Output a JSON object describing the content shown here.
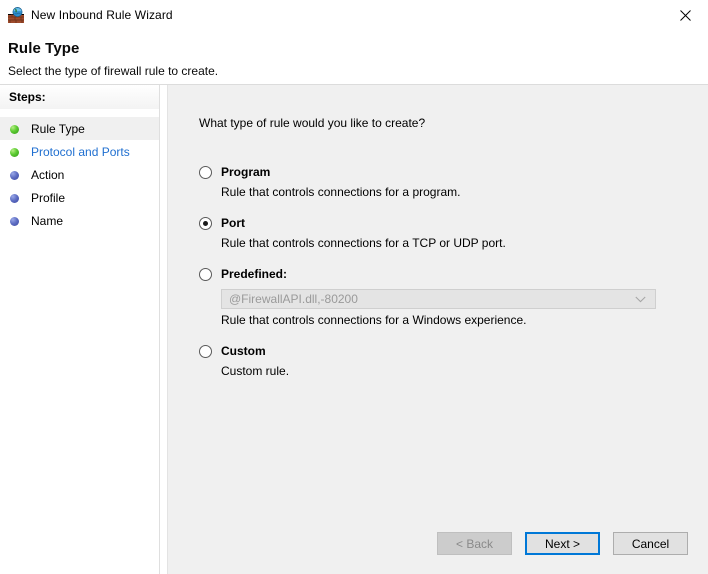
{
  "window": {
    "title": "New Inbound Rule Wizard",
    "icon": "firewall-globe-icon",
    "close_label": "close-icon"
  },
  "header": {
    "title": "Rule Type",
    "subtitle": "Select the type of firewall rule to create."
  },
  "sidebar": {
    "heading": "Steps:",
    "items": [
      {
        "label": "Rule Type",
        "state": "current",
        "bullet": "green"
      },
      {
        "label": "Protocol and Ports",
        "state": "link",
        "bullet": "green"
      },
      {
        "label": "Action",
        "state": "pending",
        "bullet": "blue"
      },
      {
        "label": "Profile",
        "state": "pending",
        "bullet": "blue"
      },
      {
        "label": "Name",
        "state": "pending",
        "bullet": "blue"
      }
    ]
  },
  "main": {
    "question": "What type of rule would you like to create?",
    "options": [
      {
        "label": "Program",
        "description": "Rule that controls connections for a program.",
        "selected": false
      },
      {
        "label": "Port",
        "description": "Rule that controls connections for a TCP or UDP port.",
        "selected": true
      },
      {
        "label": "Predefined:",
        "description": "Rule that controls connections for a Windows experience.",
        "selected": false,
        "combo_value": "@FirewallAPI.dll,-80200",
        "combo_disabled": true
      },
      {
        "label": "Custom",
        "description": "Custom rule.",
        "selected": false
      }
    ]
  },
  "footer": {
    "back_label": "< Back",
    "next_label": "Next >",
    "cancel_label": "Cancel"
  },
  "colors": {
    "accent": "#0078d7",
    "link": "#1f6fd0",
    "content_bg": "#f0f0f0",
    "step_green": "#5fcc34",
    "step_blue": "#5f6fc4"
  }
}
